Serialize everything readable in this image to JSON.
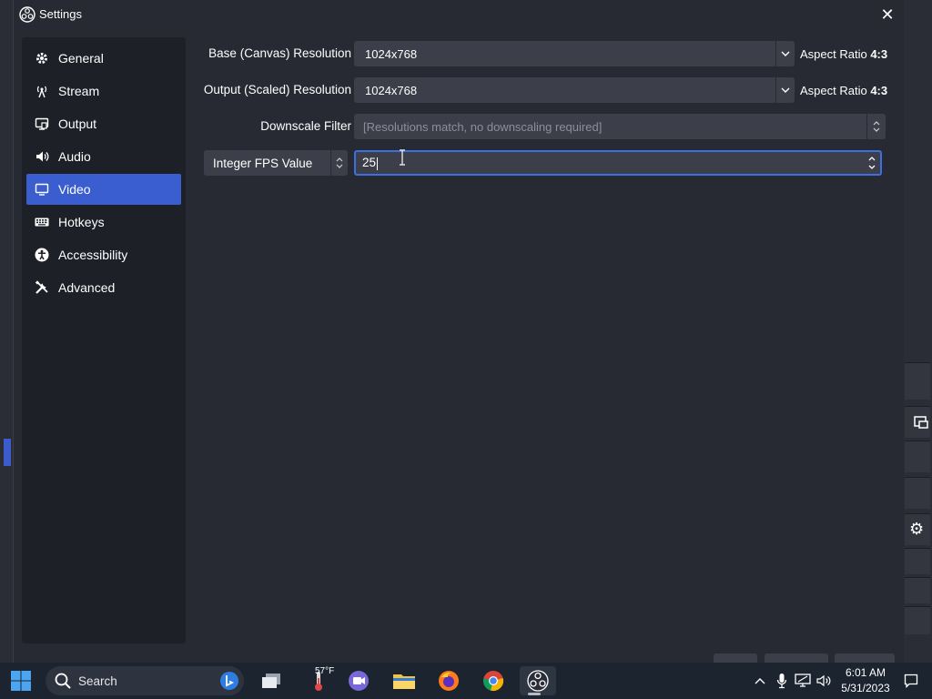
{
  "window": {
    "title": "Settings"
  },
  "sidebar": {
    "items": [
      {
        "label": "General",
        "icon": "gear-icon",
        "active": false
      },
      {
        "label": "Stream",
        "icon": "antenna-icon",
        "active": false
      },
      {
        "label": "Output",
        "icon": "output-icon",
        "active": false
      },
      {
        "label": "Audio",
        "icon": "speaker-icon",
        "active": false
      },
      {
        "label": "Video",
        "icon": "monitor-icon",
        "active": true
      },
      {
        "label": "Hotkeys",
        "icon": "keyboard-icon",
        "active": false
      },
      {
        "label": "Accessibility",
        "icon": "accessibility-icon",
        "active": false
      },
      {
        "label": "Advanced",
        "icon": "tools-icon",
        "active": false
      }
    ]
  },
  "video": {
    "base_resolution": {
      "label": "Base (Canvas) Resolution",
      "value": "1024x768",
      "aspect_prefix": "Aspect Ratio",
      "aspect_value": "4:3"
    },
    "output_resolution": {
      "label": "Output (Scaled) Resolution",
      "value": "1024x768",
      "aspect_prefix": "Aspect Ratio",
      "aspect_value": "4:3"
    },
    "downscale_filter": {
      "label": "Downscale Filter",
      "value": "[Resolutions match, no downscaling required]"
    },
    "fps": {
      "type": "Integer FPS Value",
      "value": "25"
    }
  },
  "taskbar": {
    "search_label": "Search",
    "weather_temp": "57°F",
    "time": "6:01 AM",
    "date": "5/31/2023"
  },
  "colors": {
    "accent": "#3a5ed0",
    "panel": "#272a33",
    "sidebar": "#1e2028",
    "field": "#3c3f49"
  }
}
